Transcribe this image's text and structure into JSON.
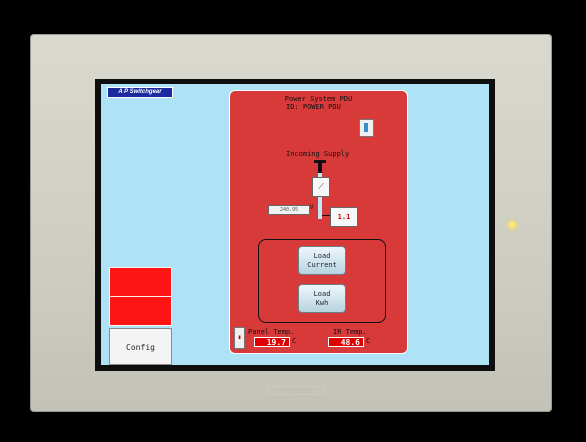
{
  "logo_text": "A P Switchgear",
  "side_panel": {
    "config_label": "Config"
  },
  "panel": {
    "title": "Power System PDU",
    "id_label": "ID: POWER PDU",
    "incoming_supply": "Incoming Supply",
    "voltage_value": "240.95",
    "voltage_unit": "V",
    "meter_text": "1.1",
    "load_current_line1": "Load",
    "load_current_line2": "Current",
    "load_kwh_line1": "Load",
    "load_kwh_line2": "Kwh",
    "panel_temp_label": "Panel Temp.",
    "panel_temp_value": "19.7",
    "ir_temp_label": "IR Temp.",
    "ir_temp_value": "48.6",
    "temp_unit": "C"
  },
  "bezel_brand": "Pro-face",
  "colors": {
    "screen_bg": "#aee2f6",
    "panel_bg": "#d83a3a",
    "alarm_red": "#ff1414"
  }
}
